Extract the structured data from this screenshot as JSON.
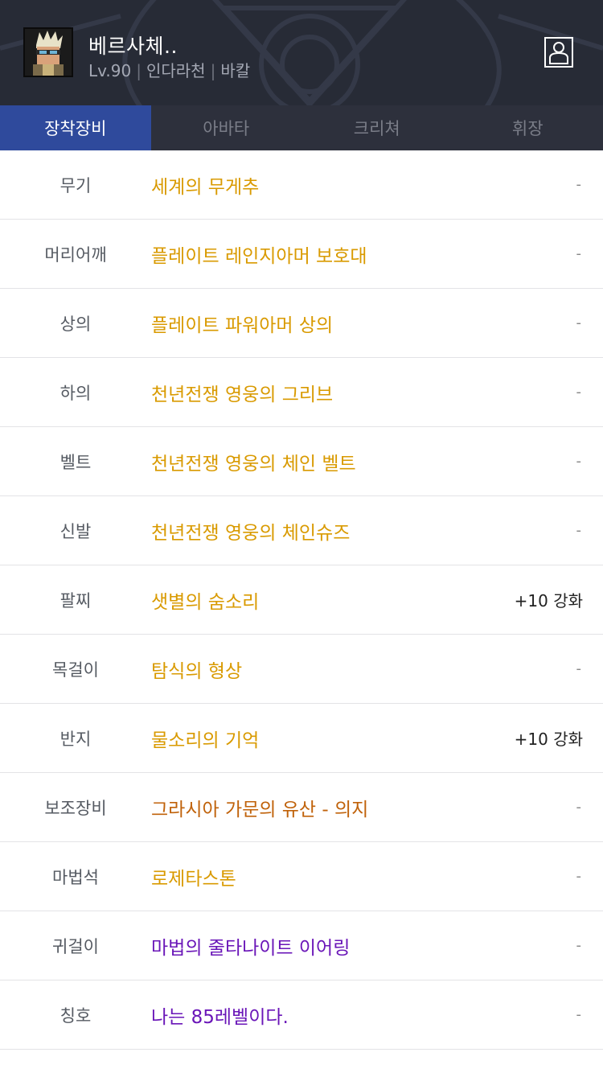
{
  "character": {
    "name": "베르사체..",
    "level": "Lv.90",
    "job": "인다라천",
    "server": "바칼",
    "separator": "|"
  },
  "header_icons": {
    "avatar": "character-portrait",
    "profile": "person-profile-icon"
  },
  "tabs": [
    {
      "label": "장착장비",
      "active": true
    },
    {
      "label": "아바타",
      "active": false
    },
    {
      "label": "크리쳐",
      "active": false
    },
    {
      "label": "휘장",
      "active": false
    }
  ],
  "colors": {
    "header_bg": "#272b36",
    "tab_active": "#2f4a9c",
    "epic": "#d4a017",
    "legendary_set": "#c76a0b",
    "unique": "#6a0dad"
  },
  "equipment": [
    {
      "slot": "무기",
      "name": "세계의 무게추",
      "color": "#d99a00",
      "enhance": "-"
    },
    {
      "slot": "머리어깨",
      "name": "플레이트 레인지아머 보호대",
      "color": "#d99a00",
      "enhance": "-"
    },
    {
      "slot": "상의",
      "name": "플레이트 파워아머 상의",
      "color": "#d99a00",
      "enhance": "-"
    },
    {
      "slot": "하의",
      "name": "천년전쟁 영웅의 그리브",
      "color": "#d99a00",
      "enhance": "-"
    },
    {
      "slot": "벨트",
      "name": "천년전쟁 영웅의 체인 벨트",
      "color": "#d99a00",
      "enhance": "-"
    },
    {
      "slot": "신발",
      "name": "천년전쟁 영웅의 체인슈즈",
      "color": "#d99a00",
      "enhance": "-"
    },
    {
      "slot": "팔찌",
      "name": "샛별의 숨소리",
      "color": "#d99a00",
      "enhance": "+10 강화"
    },
    {
      "slot": "목걸이",
      "name": "탐식의 형상",
      "color": "#d99a00",
      "enhance": "-"
    },
    {
      "slot": "반지",
      "name": "물소리의 기억",
      "color": "#d99a00",
      "enhance": "+10 강화"
    },
    {
      "slot": "보조장비",
      "name": "그라시아 가문의 유산 - 의지",
      "color": "#c0620a",
      "enhance": "-"
    },
    {
      "slot": "마법석",
      "name": "로제타스톤",
      "color": "#d99a00",
      "enhance": "-"
    },
    {
      "slot": "귀걸이",
      "name": "마법의 줄타나이트 이어링",
      "color": "#6a16b8",
      "enhance": "-"
    },
    {
      "slot": "칭호",
      "name": "나는 85레벨이다.",
      "color": "#6a16b8",
      "enhance": "-"
    }
  ]
}
